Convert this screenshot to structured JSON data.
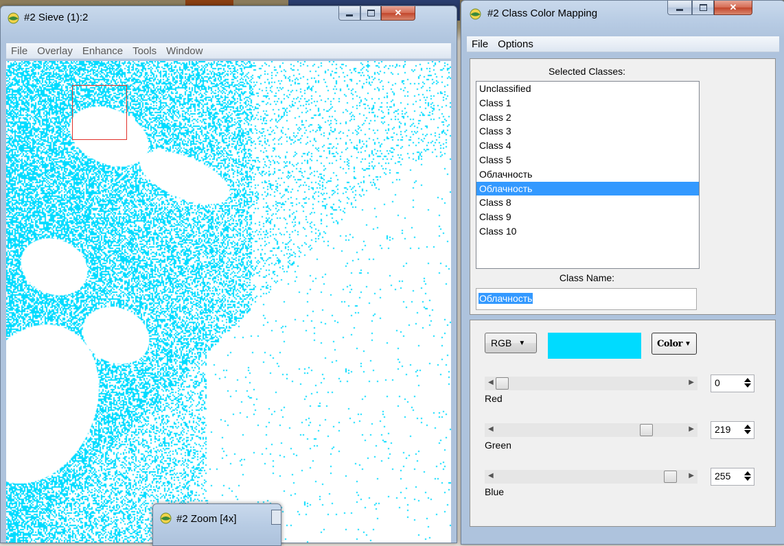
{
  "colors": {
    "pixel_cyan": "#00dbff",
    "selection_blue": "#3399ff",
    "roi_red": "#e0302a"
  },
  "sieve_window": {
    "title": "#2 Sieve (1):2",
    "menu": [
      "File",
      "Overlay",
      "Enhance",
      "Tools",
      "Window"
    ]
  },
  "zoom_window": {
    "title": "#2 Zoom [4x]"
  },
  "class_color_mapping": {
    "title": "#2 Class Color Mapping",
    "menu": [
      "File",
      "Options"
    ],
    "selected_classes_label": "Selected Classes:",
    "classes": [
      "Unclassified",
      "Class 1",
      "Class 2",
      "Class 3",
      "Class 4",
      "Class 5",
      "Облачность",
      "Облачность",
      "Class 8",
      "Class 9",
      "Class 10"
    ],
    "selected_index": 7,
    "class_name_label": "Class Name:",
    "class_name_value": "Облачность",
    "color_model": "RGB",
    "color_button": "Color",
    "current_color": "#00dbff",
    "sliders": [
      {
        "label": "Red",
        "value": "0",
        "fraction": 0.0
      },
      {
        "label": "Green",
        "value": "219",
        "fraction": 0.859
      },
      {
        "label": "Blue",
        "value": "255",
        "fraction": 1.0
      }
    ]
  }
}
